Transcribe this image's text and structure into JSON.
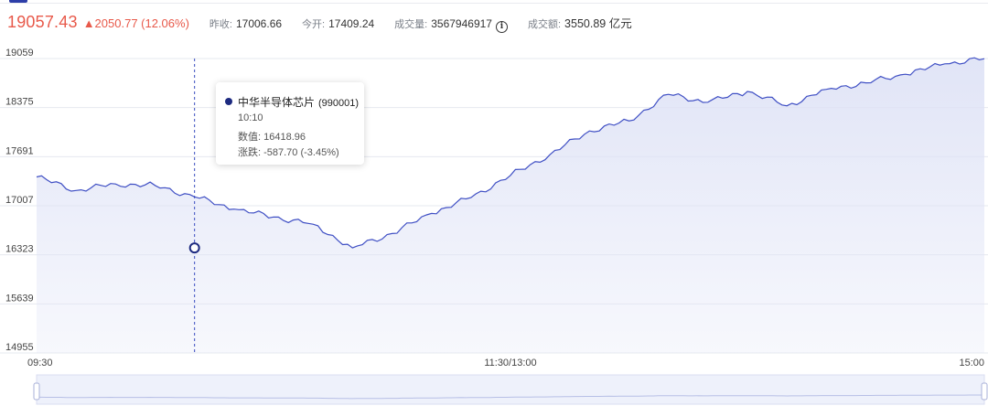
{
  "header": {
    "price": "19057.43",
    "change": "▲2050.77 (12.06%)",
    "stats": [
      {
        "label": "昨收:",
        "value": "17006.66"
      },
      {
        "label": "今开:",
        "value": "17409.24"
      },
      {
        "label": "成交量:",
        "value": "3567946917"
      },
      {
        "label": "成交额:",
        "value": "3550.89 亿元"
      }
    ],
    "info_icon": "info-icon",
    "colors": {
      "up": "#e8594a",
      "line": "#3f4fc4",
      "area": "#dfe3f6",
      "accent": "#2d3ea8"
    }
  },
  "tooltip": {
    "name": "中华半导体芯片",
    "code": "(990001)",
    "time": "10:10",
    "value_line": "数值: 16418.96",
    "change_line": "涨跌: -587.70 (-3.45%)"
  },
  "chart_data": {
    "type": "area",
    "title": "",
    "xlabel": "",
    "ylabel": "",
    "y_ticks": [
      "19059",
      "18375",
      "17691",
      "17007",
      "16323",
      "15639",
      "14955"
    ],
    "ylim": [
      14955,
      19059
    ],
    "x_ticks": [
      "09:30",
      "11:30/13:00",
      "15:00"
    ],
    "x_minutes": [
      0,
      10,
      20,
      30,
      40,
      50,
      60,
      70,
      80,
      90,
      100,
      110,
      120,
      130,
      140,
      150,
      160,
      170,
      180,
      190,
      200,
      210,
      220,
      230,
      240
    ],
    "series": [
      {
        "name": "中华半导体芯片",
        "values": [
          17409,
          17220,
          17310,
          17290,
          17130,
          16960,
          16850,
          16750,
          16419,
          16620,
          16900,
          17120,
          17430,
          17720,
          18050,
          18190,
          18560,
          18450,
          18600,
          18400,
          18630,
          18720,
          18840,
          18985,
          19057
        ]
      }
    ],
    "highlight": {
      "x": "10:10",
      "y": 16418.96
    },
    "grid": true,
    "legend": "none",
    "range_slider": true
  }
}
